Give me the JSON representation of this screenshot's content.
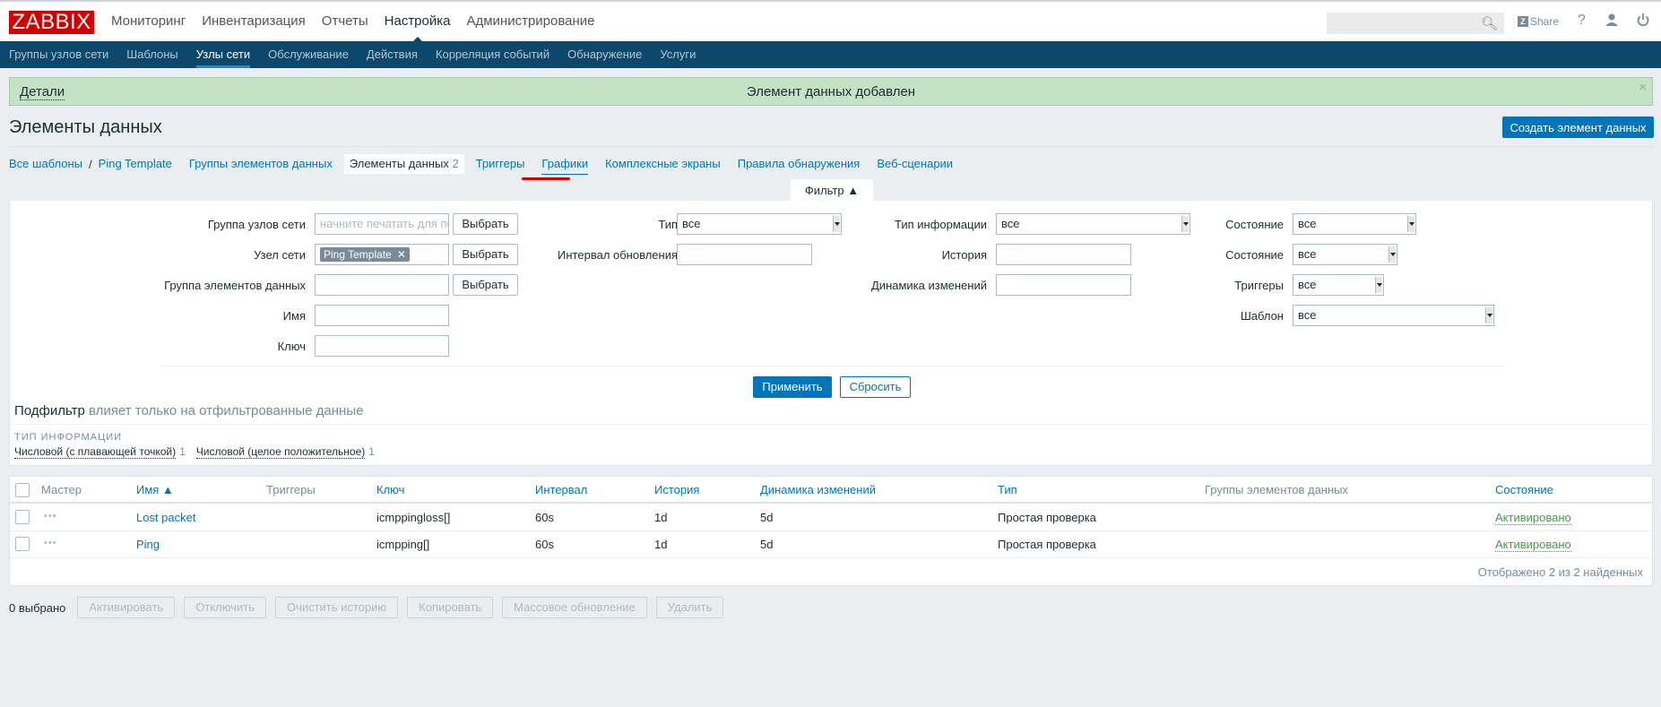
{
  "header": {
    "logo": "ZABBIX",
    "main_menu": [
      "Мониторинг",
      "Инвентаризация",
      "Отчеты",
      "Настройка",
      "Администрирование"
    ],
    "active_main": "Настройка",
    "search_value": "",
    "share_label": "Share",
    "help_label": "?",
    "icons": {
      "search": "search-icon",
      "share": "zabbix-share-icon",
      "help": "help-icon",
      "user": "user-icon",
      "logout": "power-icon"
    }
  },
  "subnav": {
    "items": [
      "Группы узлов сети",
      "Шаблоны",
      "Узлы сети",
      "Обслуживание",
      "Действия",
      "Корреляция событий",
      "Обнаружение",
      "Услуги"
    ],
    "active": "Узлы сети"
  },
  "message": {
    "details_label": "Детали",
    "text": "Элемент данных добавлен",
    "close": "×"
  },
  "page": {
    "title": "Элементы данных",
    "create_button": "Создать элемент данных"
  },
  "tabs": {
    "all_templates": "Все шаблоны",
    "separator": "/",
    "template": "Ping Template",
    "item_groups": "Группы элементов данных",
    "items": "Элементы данных",
    "items_count": "2",
    "triggers": "Триггеры",
    "graphs": "Графики",
    "screens": "Комплексные экраны",
    "discovery": "Правила обнаружения",
    "web": "Веб-сценарии"
  },
  "filter": {
    "tab_label": "Фильтр ▲",
    "host_group_label": "Группа узлов сети",
    "host_group_placeholder": "начните печатать для поиска",
    "host_label": "Узел сети",
    "host_chip": "Ping Template",
    "app_label": "Группа элементов данных",
    "name_label": "Имя",
    "key_label": "Ключ",
    "select_button": "Выбрать",
    "type_label": "Тип",
    "type_value": "все",
    "interval_label": "Интервал обновления",
    "info_type_label": "Тип информации",
    "info_type_value": "все",
    "history_label": "История",
    "trends_label": "Динамика изменений",
    "state_label": "Состояние",
    "state_value": "все",
    "status_label": "Состояние",
    "status_value": "все",
    "triggers_label": "Триггеры",
    "triggers_value": "все",
    "template_label": "Шаблон",
    "template_value": "все",
    "apply": "Применить",
    "reset": "Сбросить"
  },
  "subfilter": {
    "title": "Подфильтр",
    "hint": "влияет только на отфильтрованные данные",
    "caption": "ТИП ИНФОРМАЦИИ",
    "options": [
      {
        "label": "Числовой (с плавающей точкой)",
        "count": "1"
      },
      {
        "label": "Числовой (целое положительное)",
        "count": "1"
      }
    ]
  },
  "table": {
    "columns": [
      "Мастер",
      "Имя ▲",
      "Триггеры",
      "Ключ",
      "Интервал",
      "История",
      "Динамика изменений",
      "Тип",
      "Группы элементов данных",
      "Состояние"
    ],
    "rows": [
      {
        "master": "•••",
        "name": "Lost packet",
        "triggers": "",
        "key": "icmppingloss[]",
        "interval": "60s",
        "history": "1d",
        "trends": "5d",
        "type": "Простая проверка",
        "apps": "",
        "status": "Активировано"
      },
      {
        "master": "•••",
        "name": "Ping",
        "triggers": "",
        "key": "icmpping[]",
        "interval": "60s",
        "history": "1d",
        "trends": "5d",
        "type": "Простая проверка",
        "apps": "",
        "status": "Активировано"
      }
    ],
    "footer": "Отображено 2 из 2 найденных"
  },
  "actions": {
    "selected": "0 выбрано",
    "buttons": [
      "Активировать",
      "Отключить",
      "Очистить историю",
      "Копировать",
      "Массовое обновление",
      "Удалить"
    ]
  }
}
